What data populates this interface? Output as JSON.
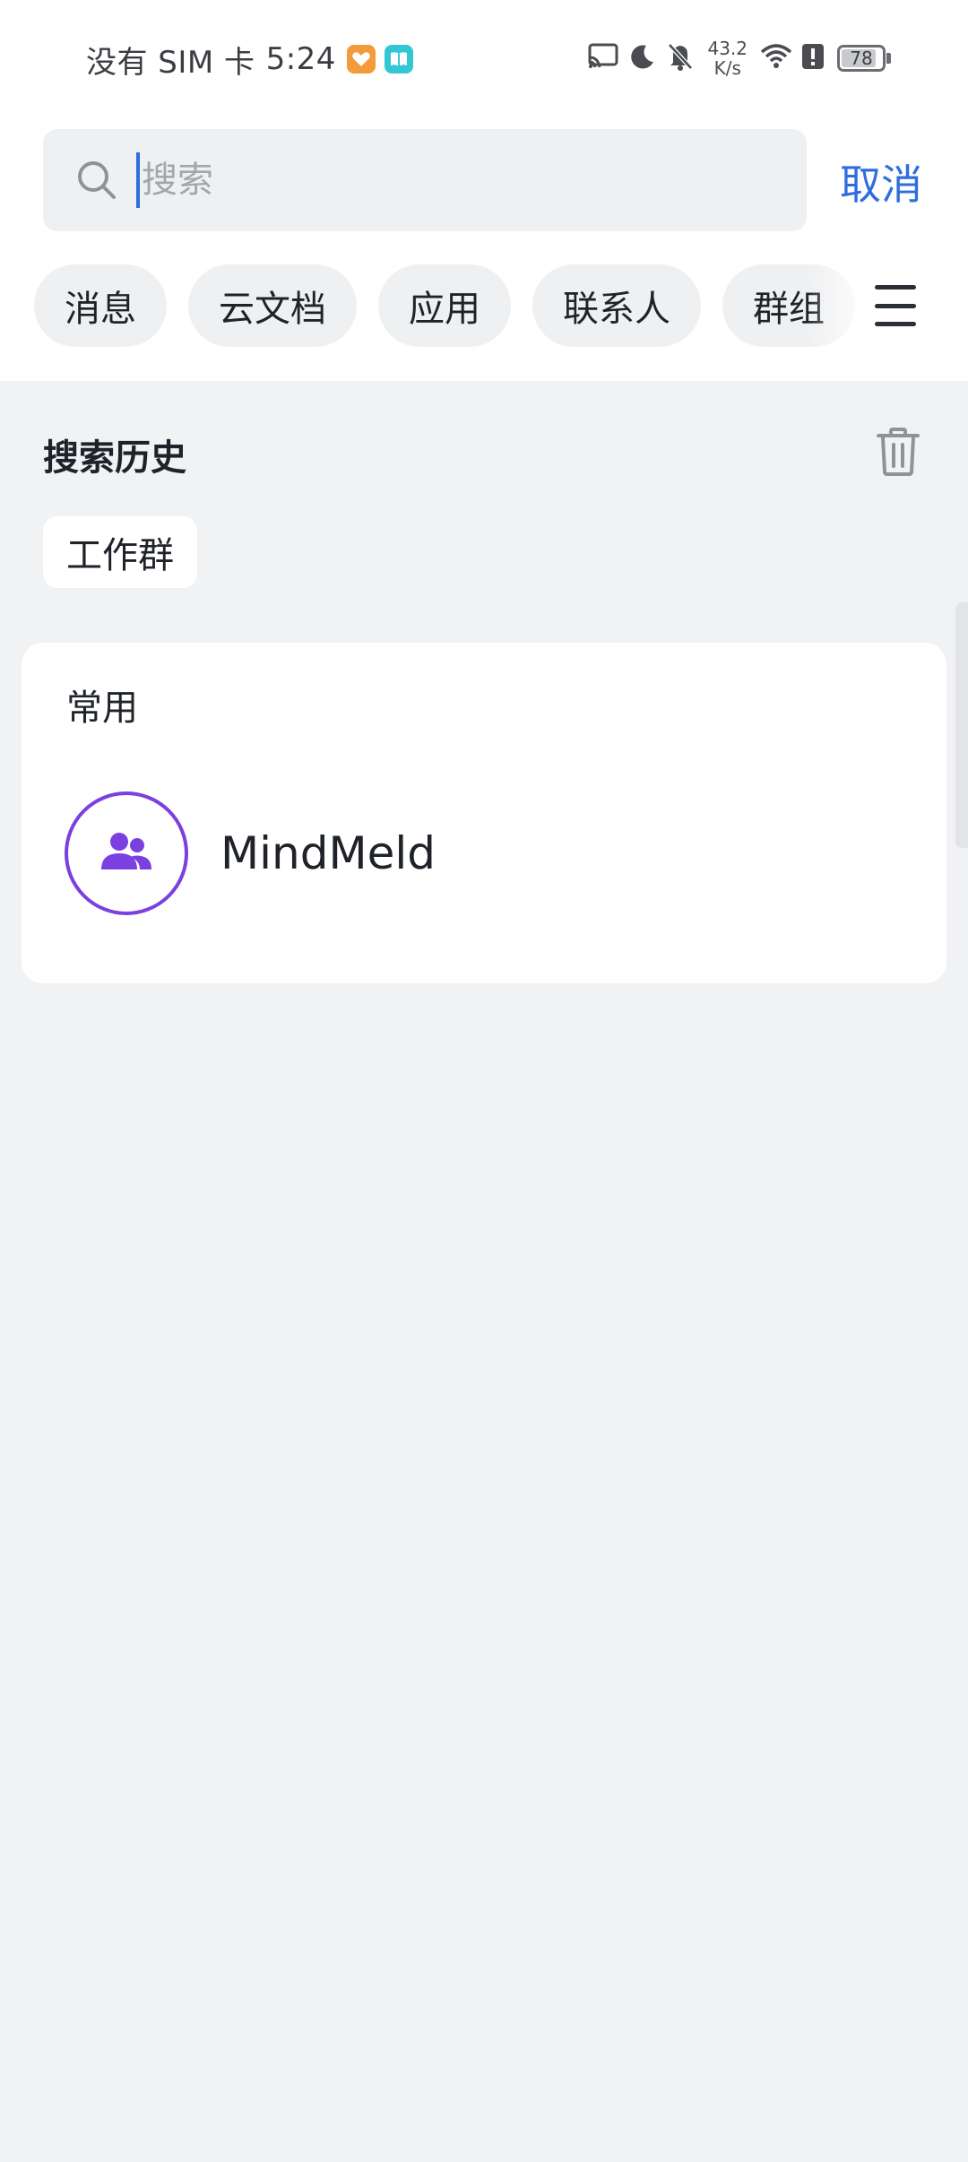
{
  "status_bar": {
    "carrier": "没有 SIM 卡",
    "time": "5:24",
    "net_speed_value": "43.2",
    "net_speed_unit": "K/s",
    "battery_level": "78",
    "icons": [
      "cast-icon",
      "moon-icon",
      "bell-off-icon",
      "wifi-icon",
      "alert-icon",
      "battery-icon"
    ]
  },
  "search": {
    "placeholder": "搜索",
    "value": "",
    "cancel_label": "取消"
  },
  "filters": {
    "chips": [
      "消息",
      "云文档",
      "应用",
      "联系人",
      "群组"
    ],
    "menu_icon": "hamburger-menu-icon"
  },
  "history": {
    "title": "搜索历史",
    "items": [
      "工作群"
    ],
    "clear_icon": "trash-icon"
  },
  "common": {
    "title": "常用",
    "items": [
      {
        "name": "MindMeld",
        "icon": "group-icon"
      }
    ]
  },
  "colors": {
    "accent": "#2F6DDE",
    "avatar_ring": "#7C3FE0",
    "page_bg": "#F1F2F4",
    "chip_bg": "#EFF0F1"
  }
}
